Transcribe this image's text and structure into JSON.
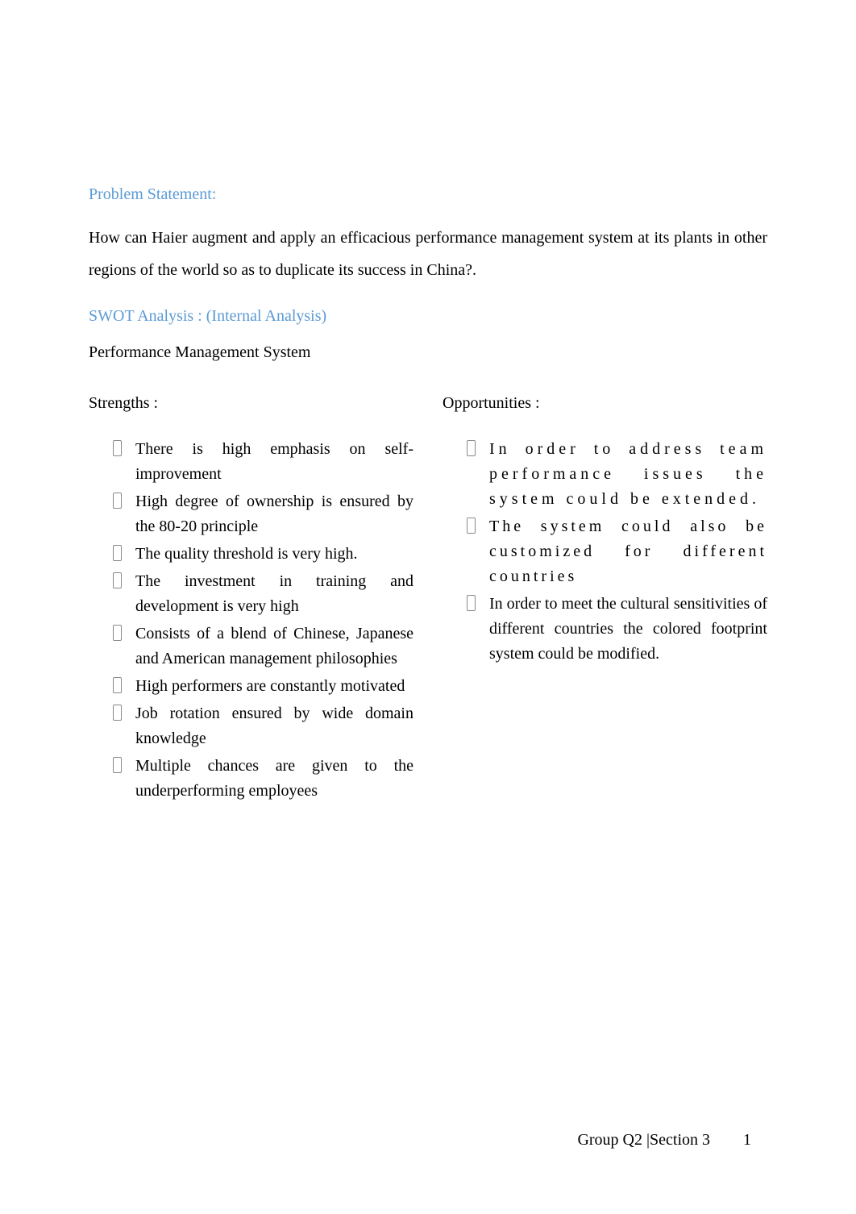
{
  "sections": {
    "problem": {
      "heading": "Problem Statement:",
      "body": "How can Haier augment and apply an efficacious performance management system at its plants in other regions of the world so as to duplicate its success in China?."
    },
    "swot": {
      "heading": "SWOT Analysis : (Internal Analysis)",
      "subheading": "Performance Management System"
    },
    "strengths": {
      "title": "Strengths :",
      "items": [
        "There is high emphasis on self-improvement",
        "High degree of ownership is ensured by the 80-20 principle",
        "The quality threshold is very high.",
        "The investment in training and development is very high",
        "Consists of a blend of Chinese, Japanese and American management philosophies",
        "High performers are constantly motivated",
        "Job rotation ensured by wide domain knowledge",
        "Multiple chances are given to the underperforming employees"
      ]
    },
    "opportunities": {
      "title": "Opportunities :",
      "items": [
        "In order to address team performance issues the system could be extended.",
        "The system could also be customized for different countries",
        "In order to meet the cultural sensitivities of different countries the colored footprint system could be modified."
      ]
    }
  },
  "footer": {
    "group": "Group Q2 |Section 3",
    "page": "1"
  }
}
